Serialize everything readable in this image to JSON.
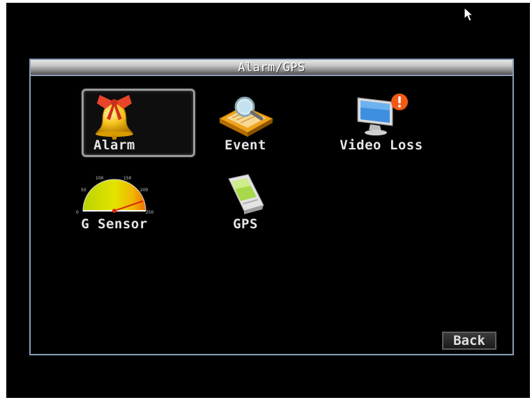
{
  "window": {
    "title": "Alarm/GPS"
  },
  "menu": {
    "items": [
      {
        "label": "Alarm",
        "icon": "bell-icon",
        "selected": true
      },
      {
        "label": "Event",
        "icon": "event-search-icon",
        "selected": false
      },
      {
        "label": "Video Loss",
        "icon": "monitor-alert-icon",
        "selected": false
      },
      {
        "label": "G Sensor",
        "icon": "gauge-icon",
        "selected": false
      },
      {
        "label": "GPS",
        "icon": "gps-device-icon",
        "selected": false
      }
    ]
  },
  "footer": {
    "back_label": "Back"
  },
  "gauge_marks": [
    "0",
    "50",
    "100",
    "150",
    "200",
    "250"
  ],
  "colors": {
    "background": "#000000",
    "window_border": "#8c9fb8",
    "label_text": "#e6e6e6"
  }
}
